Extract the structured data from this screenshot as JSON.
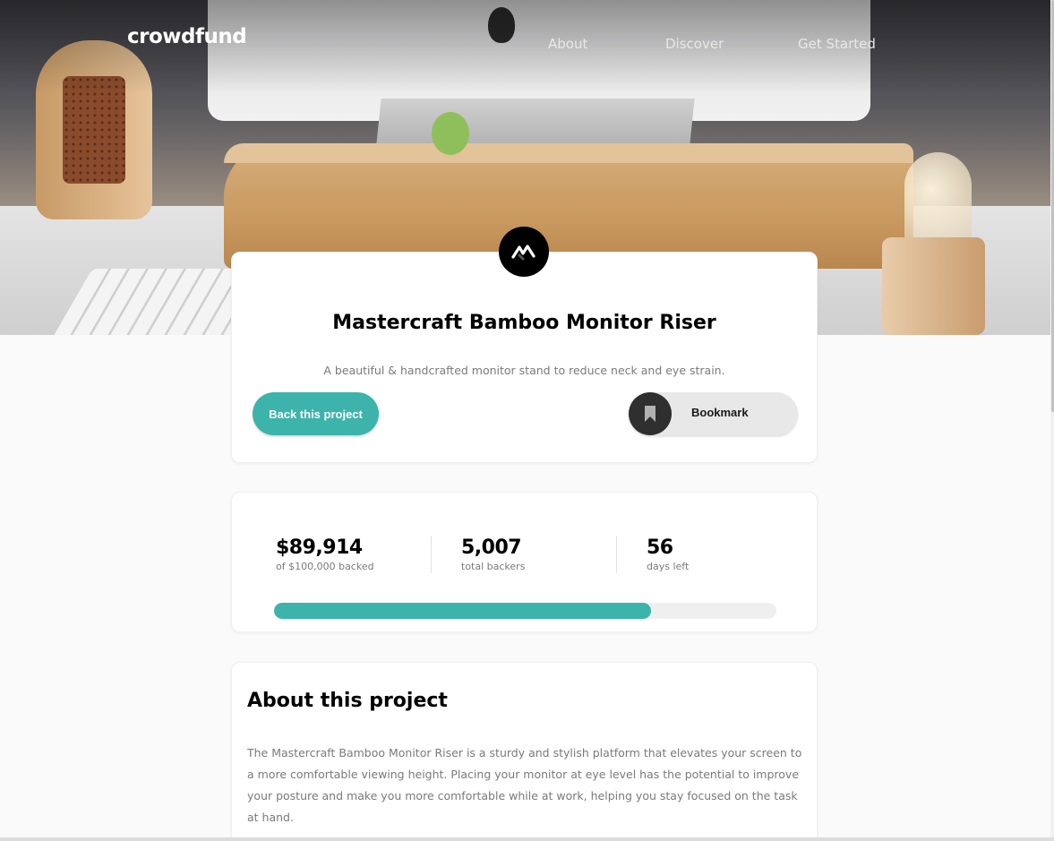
{
  "header": {
    "logo": "crowdfund",
    "nav": [
      "About",
      "Discover",
      "Get Started"
    ]
  },
  "project": {
    "title": "Mastercraft Bamboo Monitor Riser",
    "description": "A beautiful & handcrafted monitor stand to reduce neck and eye strain.",
    "back_label": "Back this project",
    "bookmark_label": "Bookmark"
  },
  "stats": {
    "backed_value": "$89,914",
    "backed_label": "of $100,000 backed",
    "backers_value": "5,007",
    "backers_label": "total backers",
    "days_value": "56",
    "days_label": "days left",
    "progress_percent": 75
  },
  "about": {
    "title": "About this project",
    "text": "The Mastercraft Bamboo Monitor Riser is a sturdy and stylish platform that elevates your screen to a more comfortable viewing height. Placing your monitor at eye level has the potential to improve your posture and make you more comfortable while at work, helping you stay focused on the task at hand."
  },
  "colors": {
    "accent": "#3cb3ab",
    "dark": "#2f2f2f"
  },
  "icons": {
    "project_logo": "mastercraft-logo-icon",
    "bookmark": "bookmark-icon"
  }
}
